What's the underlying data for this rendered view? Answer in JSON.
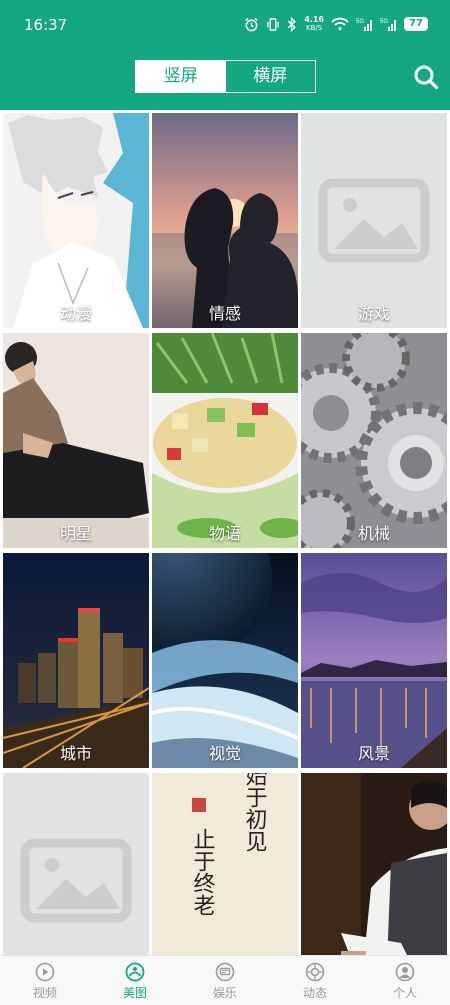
{
  "status_bar": {
    "time": "16:37",
    "net_speed": "4.16",
    "net_unit": "KB/S",
    "battery": "77",
    "icons": [
      "alarm-icon",
      "vibrate-icon",
      "bluetooth-icon",
      "wifi-icon",
      "signal-5g-icon",
      "signal-5g-icon",
      "battery-icon"
    ]
  },
  "header": {
    "tabs": [
      {
        "label": "竖屏",
        "active": true
      },
      {
        "label": "横屏",
        "active": false
      }
    ],
    "search_icon": "search-icon",
    "accent_color": "#13a882"
  },
  "categories": [
    {
      "label": "动漫",
      "image": "anime-boy"
    },
    {
      "label": "情感",
      "image": "couple-sunset"
    },
    {
      "label": "游戏",
      "image": "placeholder"
    },
    {
      "label": "明星",
      "image": "celebrity"
    },
    {
      "label": "物语",
      "image": "food-dish"
    },
    {
      "label": "机械",
      "image": "gears"
    },
    {
      "label": "城市",
      "image": "city-night"
    },
    {
      "label": "视觉",
      "image": "planet-clouds"
    },
    {
      "label": "风景",
      "image": "lake-dusk"
    },
    {
      "label": "",
      "image": "placeholder"
    },
    {
      "label": "",
      "image": "calligraphy"
    },
    {
      "label": "",
      "image": "man-vest"
    }
  ],
  "calligraphy_text": {
    "right": "始于初见",
    "left": "止于终老"
  },
  "tabbar": {
    "items": [
      {
        "label": "视频",
        "icon": "play-icon",
        "active": false
      },
      {
        "label": "美图",
        "icon": "picture-icon",
        "active": true
      },
      {
        "label": "娱乐",
        "icon": "message-icon",
        "active": false
      },
      {
        "label": "动态",
        "icon": "camera-icon",
        "active": false
      },
      {
        "label": "个人",
        "icon": "user-icon",
        "active": false
      }
    ]
  }
}
